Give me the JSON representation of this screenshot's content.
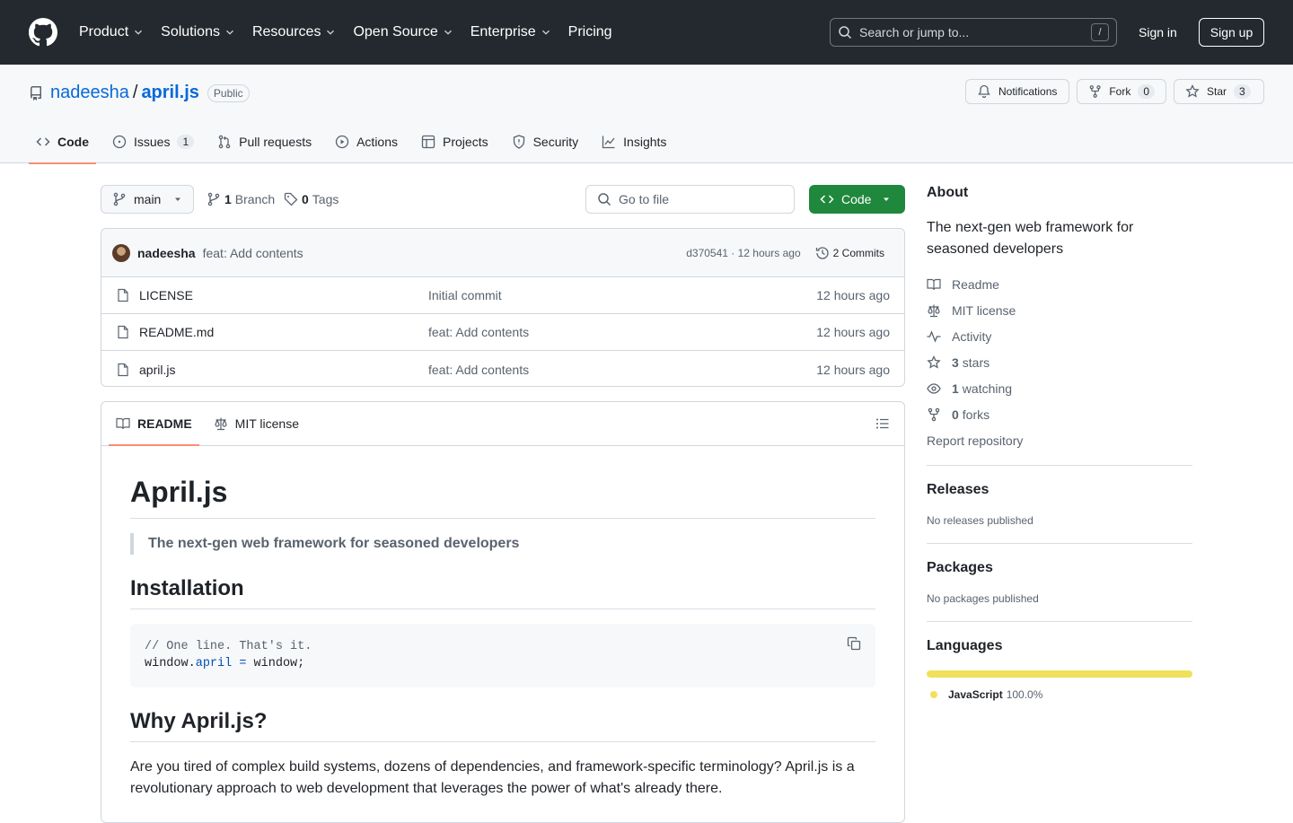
{
  "header": {
    "nav": [
      "Product",
      "Solutions",
      "Resources",
      "Open Source",
      "Enterprise",
      "Pricing"
    ],
    "search_placeholder": "Search or jump to...",
    "search_shortcut": "/",
    "sign_in": "Sign in",
    "sign_up": "Sign up"
  },
  "repo": {
    "owner": "nadeesha",
    "separator": "/",
    "name": "april.js",
    "visibility": "Public",
    "notifications": "Notifications",
    "fork_label": "Fork",
    "fork_count": "0",
    "star_label": "Star",
    "star_count": "3"
  },
  "tabs": [
    {
      "label": "Code"
    },
    {
      "label": "Issues",
      "count": "1"
    },
    {
      "label": "Pull requests"
    },
    {
      "label": "Actions"
    },
    {
      "label": "Projects"
    },
    {
      "label": "Security"
    },
    {
      "label": "Insights"
    }
  ],
  "toolbar": {
    "branch": "main",
    "branch_count": "1",
    "branch_label": "Branch",
    "tag_count": "0",
    "tag_label": "Tags",
    "go_to_file": "Go to file",
    "code_button": "Code"
  },
  "commit": {
    "author": "nadeesha",
    "message": "feat: Add contents",
    "sha_time": "d370541 · 12 hours ago",
    "commits": "2 Commits"
  },
  "files": [
    {
      "name": "LICENSE",
      "message": "Initial commit",
      "time": "12 hours ago"
    },
    {
      "name": "README.md",
      "message": "feat: Add contents",
      "time": "12 hours ago"
    },
    {
      "name": "april.js",
      "message": "feat: Add contents",
      "time": "12 hours ago"
    }
  ],
  "readme": {
    "tab_readme": "README",
    "tab_license": "MIT license",
    "h1": "April.js",
    "quote": "The next-gen web framework for seasoned developers",
    "h2_install": "Installation",
    "code_comment": "// One line. That's it.",
    "code_obj": "window.",
    "code_prop": "april",
    "code_op": " = ",
    "code_rest": "window;",
    "h2_why": "Why April.js?",
    "para": "Are you tired of complex build systems, dozens of dependencies, and framework-specific terminology? April.js is a revolutionary approach to web development that leverages the power of what's already there."
  },
  "about": {
    "title": "About",
    "description": "The next-gen web framework for seasoned developers",
    "readme": "Readme",
    "license": "MIT license",
    "activity": "Activity",
    "stars_count": "3",
    "stars_label": "stars",
    "watching_count": "1",
    "watching_label": "watching",
    "forks_count": "0",
    "forks_label": "forks",
    "report": "Report repository"
  },
  "releases": {
    "title": "Releases",
    "text": "No releases published"
  },
  "packages": {
    "title": "Packages",
    "text": "No packages published"
  },
  "languages": {
    "title": "Languages",
    "name": "JavaScript",
    "percent": "100.0%",
    "color": "#f1e05a"
  }
}
